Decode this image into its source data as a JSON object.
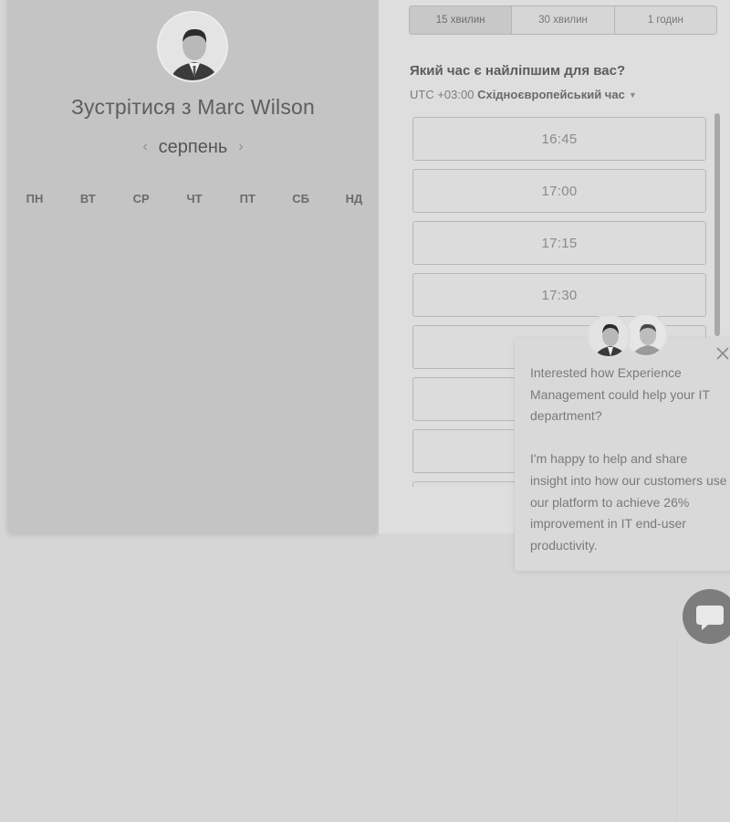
{
  "scheduler": {
    "title": "Зустрітися з Marc Wilson",
    "month": "серпень",
    "prev_icon": "chevron-left-icon",
    "next_icon": "chevron-right-icon",
    "weekdays": [
      "ПН",
      "ВТ",
      "СР",
      "ЧТ",
      "ПТ",
      "СБ",
      "НД"
    ]
  },
  "durations": [
    {
      "label": "15 хвилин",
      "selected": true
    },
    {
      "label": "30 хвилин",
      "selected": false
    },
    {
      "label": "1 годин",
      "selected": false
    }
  ],
  "time_question": "Який час є найліпшим для вас?",
  "timezone": {
    "offset": "UTC +03:00",
    "name": "Східноєвропейський час"
  },
  "slots": [
    "16:45",
    "17:00",
    "17:15",
    "17:30",
    "",
    "",
    "",
    ""
  ],
  "chat_popup": {
    "message_1": "Interested how Experience Management could help your IT department?",
    "message_2": "I'm happy to help and share insight into how our customers use our platform to achieve 26% improvement in IT end-user productivity.",
    "close_icon": "close-icon"
  },
  "chat_launcher_icon": "chat-bubble-icon",
  "colors": {
    "page_bg": "#d6d6d6",
    "left_panel": "#c4c4c4",
    "right_panel": "#dedede"
  }
}
